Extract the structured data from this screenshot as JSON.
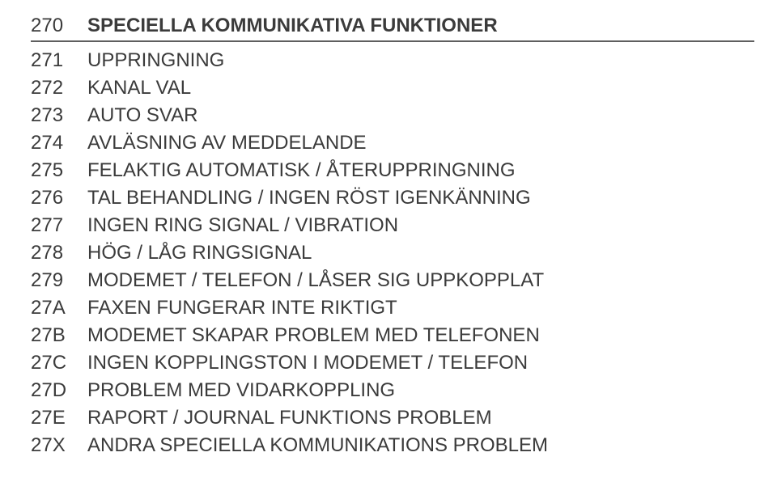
{
  "header": {
    "code": "270",
    "title": "SPECIELLA KOMMUNIKATIVA FUNKTIONER"
  },
  "rows": [
    {
      "code": "271",
      "text": "UPPRINGNING"
    },
    {
      "code": "272",
      "text": "KANAL VAL"
    },
    {
      "code": "273",
      "text": "AUTO SVAR"
    },
    {
      "code": "274",
      "text": "AVLÄSNING AV MEDDELANDE"
    },
    {
      "code": "275",
      "text": "FELAKTIG AUTOMATISK / ÅTERUPPRINGNING"
    },
    {
      "code": "276",
      "text": "TAL BEHANDLING / INGEN RÖST IGENKÄNNING"
    },
    {
      "code": "277",
      "text": "INGEN RING SIGNAL / VIBRATION"
    },
    {
      "code": "278",
      "text": "HÖG / LÅG RINGSIGNAL"
    },
    {
      "code": "279",
      "text": "MODEMET / TELEFON / LÅSER SIG UPPKOPPLAT"
    },
    {
      "code": "27A",
      "text": "FAXEN FUNGERAR INTE RIKTIGT"
    },
    {
      "code": "27B",
      "text": "MODEMET SKAPAR PROBLEM MED TELEFONEN"
    },
    {
      "code": "27C",
      "text": "INGEN KOPPLINGSTON I MODEMET / TELEFON"
    },
    {
      "code": "27D",
      "text": "PROBLEM MED VIDARKOPPLING"
    },
    {
      "code": "27E",
      "text": "RAPORT / JOURNAL FUNKTIONS PROBLEM"
    },
    {
      "code": "27X",
      "text": "ANDRA SPECIELLA KOMMUNIKATIONS PROBLEM"
    }
  ]
}
